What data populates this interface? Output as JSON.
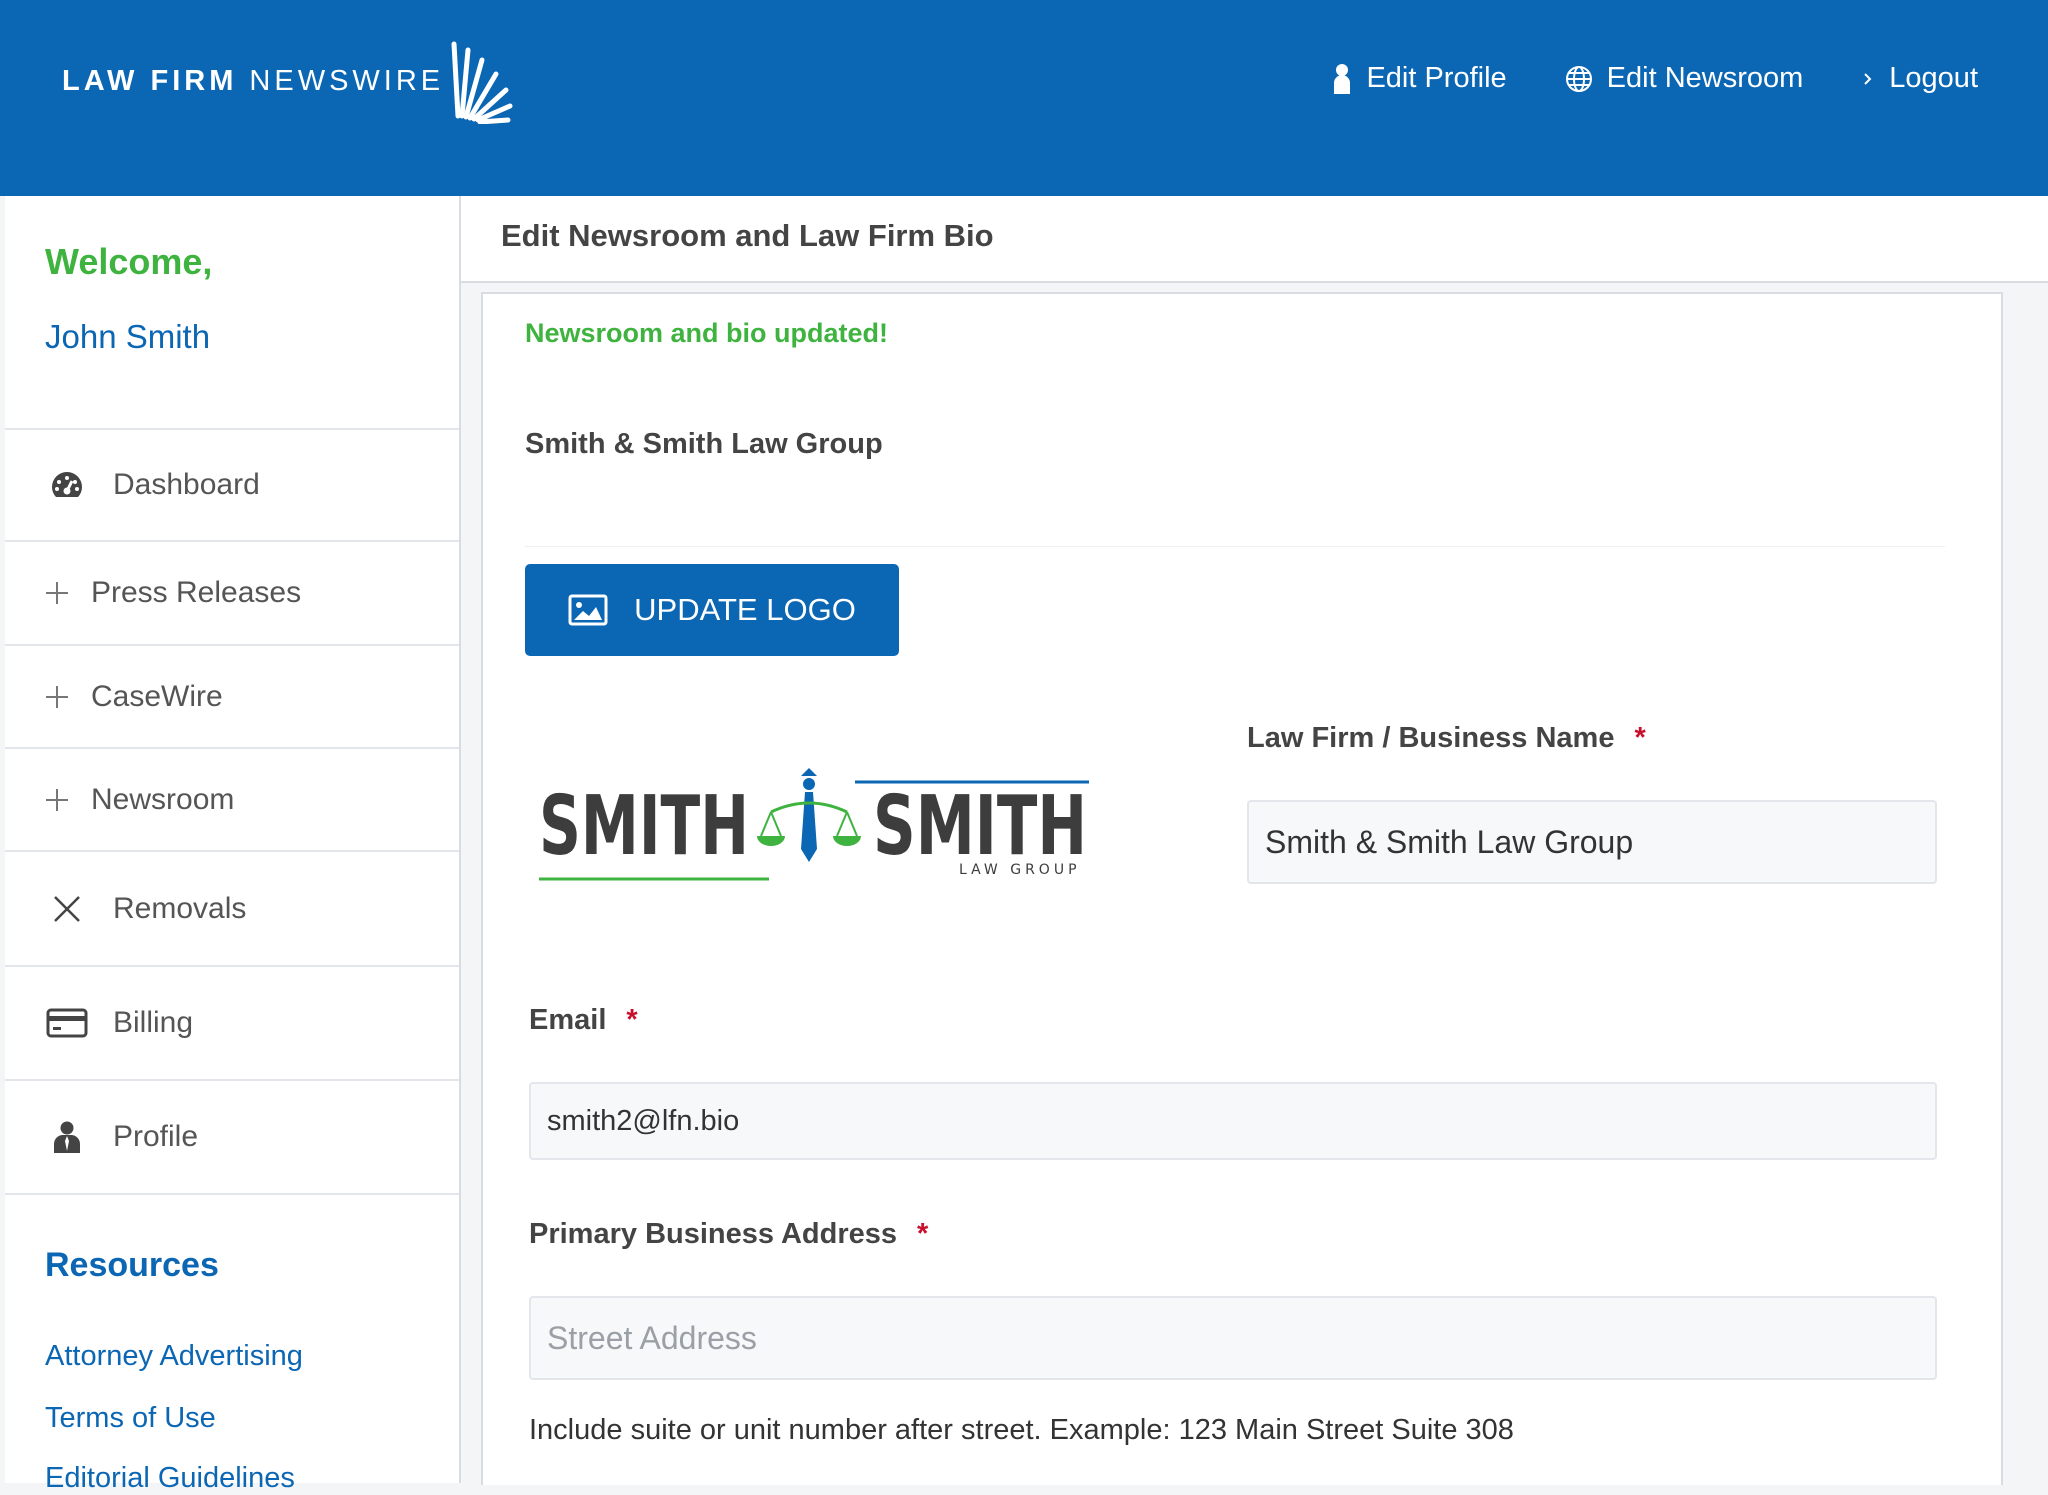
{
  "header": {
    "brand_bold": "LAW FIRM",
    "brand_light": "NEWSWIRE",
    "nav": {
      "edit_profile": "Edit Profile",
      "edit_newsroom": "Edit Newsroom",
      "logout": "Logout"
    }
  },
  "sidebar": {
    "welcome": "Welcome,",
    "username": "John Smith",
    "items": [
      {
        "label": "Dashboard",
        "icon": "dashboard-icon"
      },
      {
        "label": "Press Releases",
        "icon": "plus-icon"
      },
      {
        "label": "CaseWire",
        "icon": "plus-icon"
      },
      {
        "label": "Newsroom",
        "icon": "plus-icon"
      },
      {
        "label": "Removals",
        "icon": "close-icon"
      },
      {
        "label": "Billing",
        "icon": "credit-card-icon"
      },
      {
        "label": "Profile",
        "icon": "user-icon"
      }
    ],
    "resources_title": "Resources",
    "resources": [
      "Attorney Advertising",
      "Terms of Use",
      "Editorial Guidelines"
    ]
  },
  "main": {
    "page_title": "Edit Newsroom and Law Firm Bio",
    "success_message": "Newsroom and bio updated!",
    "firm_heading": "Smith & Smith Law Group",
    "update_logo_label": "UPDATE LOGO",
    "logo": {
      "left": "SMITH",
      "right": "SMITH",
      "sub": "LAW GROUP"
    },
    "form": {
      "business_name_label": "Law Firm / Business Name",
      "business_name_value": "Smith & Smith Law Group",
      "email_label": "Email",
      "email_value": "smith2@lfn.bio",
      "address_label": "Primary Business Address",
      "address_placeholder": "Street Address",
      "address_help": "Include suite or unit number after street. Example: 123 Main Street Suite 308",
      "required_mark": "*"
    }
  },
  "colors": {
    "primary": "#0b66b3",
    "success": "#3fb33f",
    "required": "#c8102e"
  }
}
